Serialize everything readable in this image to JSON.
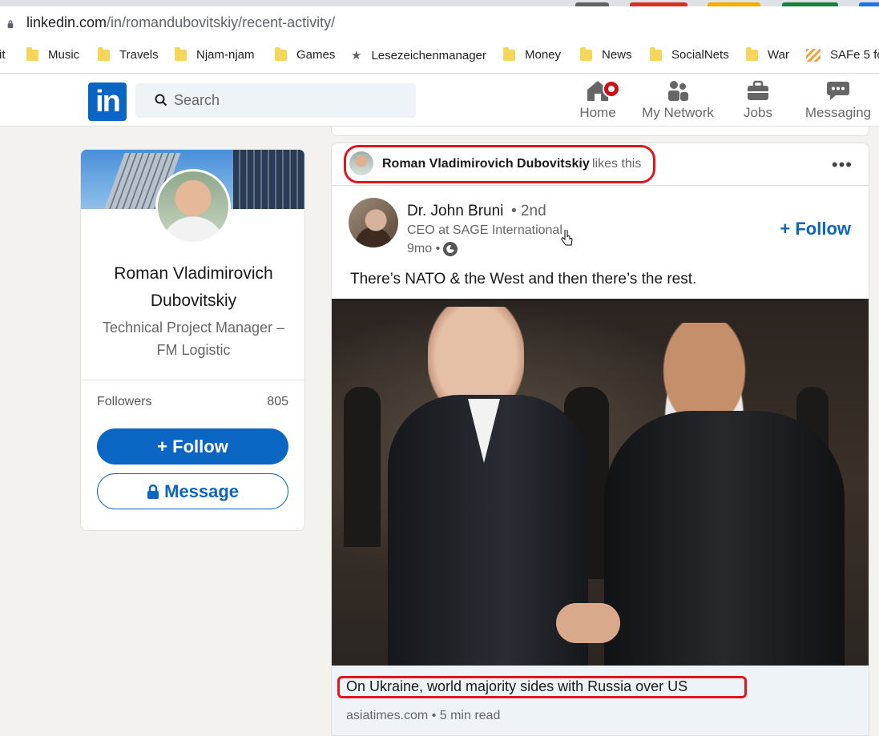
{
  "browser": {
    "url_host": "linkedin.com",
    "url_path": "/in/romandubovitskiy/recent-activity/",
    "bookmarks": [
      "it",
      "Music",
      "Travels",
      "Njam-njam",
      "Games",
      "Lesezeichenmanager",
      "Money",
      "News",
      "SocialNets",
      "War",
      "SAFe 5 fo"
    ]
  },
  "header": {
    "logo": "in",
    "search_placeholder": "Search",
    "nav": [
      {
        "label": "Home",
        "icon": "home-icon",
        "badge": true
      },
      {
        "label": "My Network",
        "icon": "network-icon"
      },
      {
        "label": "Jobs",
        "icon": "briefcase-icon"
      },
      {
        "label": "Messaging",
        "icon": "messaging-icon"
      }
    ]
  },
  "profile": {
    "name": "Roman Vladimirovich Dubovitskiy",
    "title": "Technical Project Manager – FM Logistic",
    "followers_label": "Followers",
    "followers_count": "805",
    "follow_label": "Follow",
    "message_label": "Message"
  },
  "post": {
    "activity_actor": "Roman Vladimirovich Dubovitskiy",
    "activity_verb": "likes this",
    "more_label": "•••",
    "author_name": "Dr. John Bruni",
    "author_degree": "• 2nd",
    "author_headline": "CEO at SAGE International",
    "time": "9mo •",
    "follow_label": "Follow",
    "text": "There’s NATO & the West and then there’s the rest.",
    "link_title": "On Ukraine, world majority sides with Russia over US",
    "link_source": "asiatimes.com • 5 min read"
  },
  "colors": {
    "brand": "#0a66c2",
    "highlight": "#e2141c",
    "badge": "#cc1016"
  }
}
